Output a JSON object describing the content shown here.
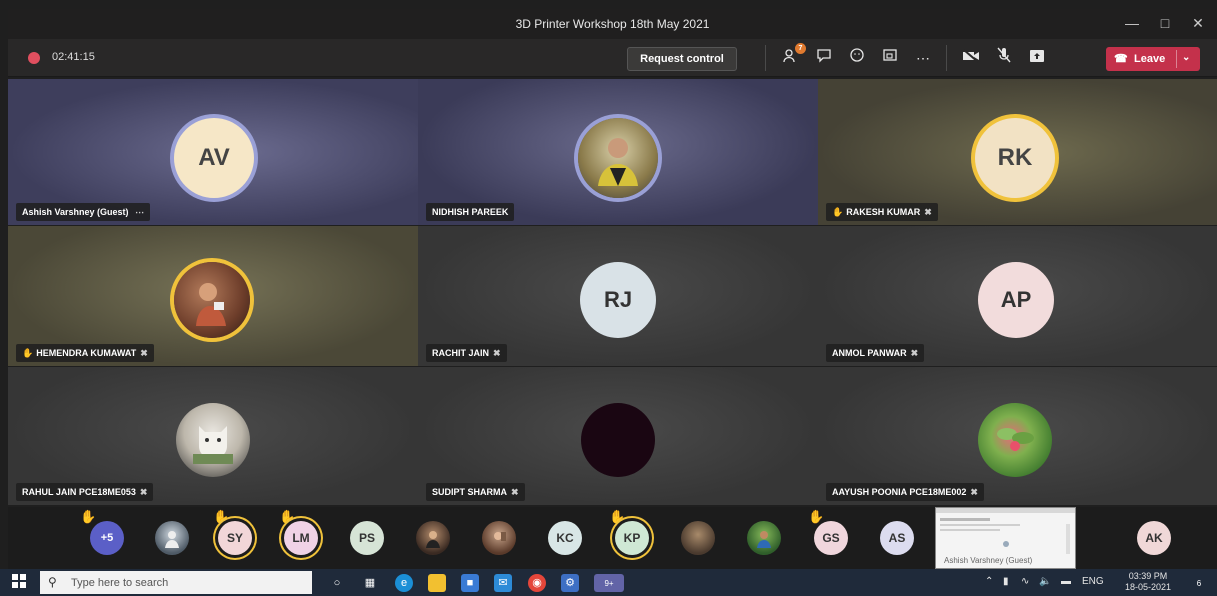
{
  "window": {
    "title": "3D Printer Workshop 18th May 2021"
  },
  "toolbar": {
    "timer": "02:41:15",
    "request_control_label": "Request control",
    "participants_badge": "7",
    "leave_label": "Leave"
  },
  "tiles": [
    {
      "name": "Ashish Varshney (Guest)",
      "initials": "AV",
      "extra": "⋯"
    },
    {
      "name": "NIDHISH PAREEK"
    },
    {
      "name": "RAKESH KUMAR",
      "initials": "RK"
    },
    {
      "name": "HEMENDRA KUMAWAT"
    },
    {
      "name": "RACHIT JAIN",
      "initials": "RJ"
    },
    {
      "name": "ANMOL PANWAR",
      "initials": "AP"
    },
    {
      "name": "RAHUL JAIN PCE18ME053"
    },
    {
      "name": "SUDIPT SHARMA"
    },
    {
      "name": "AAYUSH POONIA PCE18ME002"
    }
  ],
  "roster": {
    "overflow": "+5",
    "initials": [
      "SY",
      "LM",
      "PS",
      "KC",
      "KP",
      "GS",
      "AS",
      "AK"
    ],
    "share_caption": "Ashish Varshney (Guest)"
  },
  "taskbar": {
    "search_placeholder": "Type here to search",
    "teams_badge": "9+",
    "language": "ENG",
    "time": "03:39 PM",
    "date": "18-05-2021",
    "notification_count": "6"
  },
  "icons": {
    "hand": "raised-hand-icon",
    "mic_off": "mic-off-icon"
  }
}
